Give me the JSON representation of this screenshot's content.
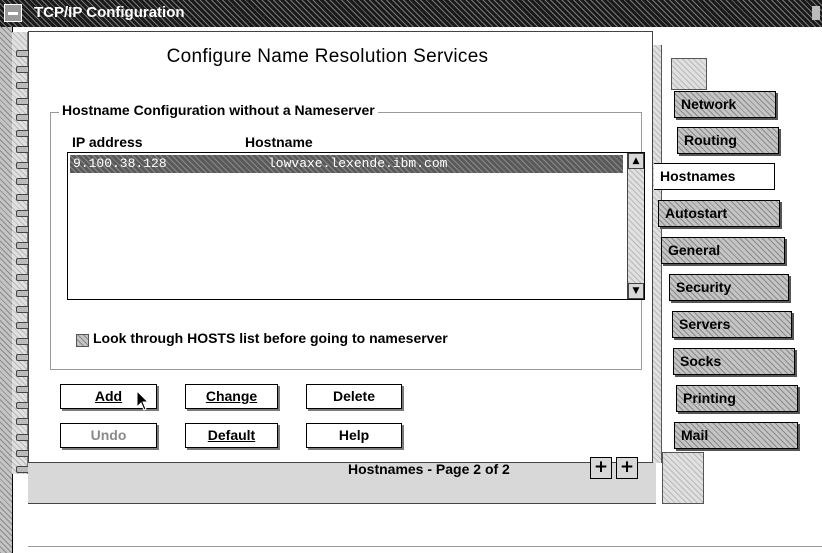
{
  "window": {
    "title": "TCP/IP Configuration"
  },
  "page": {
    "header": "Configure  Name  Resolution  Services"
  },
  "group": {
    "title": "Hostname Configuration without a Nameserver"
  },
  "table": {
    "columns": [
      "IP address",
      "Hostname"
    ],
    "rows": [
      {
        "ip": "9.100.38.128",
        "hostname": "lowvaxe.lexende.ibm.com",
        "selected": true
      }
    ]
  },
  "checkbox": {
    "label": "Look through HOSTS list before going to nameserver",
    "checked": false
  },
  "buttons": {
    "add": "Add",
    "change": "Change",
    "delete": "Delete",
    "undo": "Undo",
    "default": "Default",
    "help": "Help"
  },
  "footer": {
    "page_label": "Hostnames - Page 2 of 2",
    "prev": "+",
    "next": "+"
  },
  "tabs": [
    "Network",
    "Routing",
    "Hostnames",
    "Autostart",
    "General",
    "Security",
    "Servers",
    "Socks",
    "Printing",
    "Mail"
  ],
  "active_tab": "Hostnames",
  "colors": {
    "selection": "#5a5a5a",
    "titlebar": "#1a1a1a",
    "tab_fill": "#bdbdbd"
  }
}
